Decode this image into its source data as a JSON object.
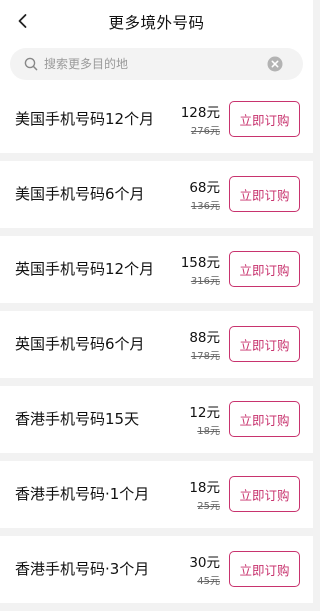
{
  "header": {
    "title": "更多境外号码",
    "back_icon": "chevron-left-icon"
  },
  "search": {
    "placeholder": "搜索更多目的地",
    "value": "",
    "search_icon": "search-icon",
    "clear_icon": "clear-icon"
  },
  "colors": {
    "accent": "#c8336e",
    "background": "#f2f2f2"
  },
  "items": [
    {
      "name": "美国手机号码12个月",
      "price": "128元",
      "original_price": "276元",
      "button": "立即订购"
    },
    {
      "name": "美国手机号码6个月",
      "price": "68元",
      "original_price": "136元",
      "button": "立即订购"
    },
    {
      "name": "英国手机号码12个月",
      "price": "158元",
      "original_price": "316元",
      "button": "立即订购"
    },
    {
      "name": "英国手机号码6个月",
      "price": "88元",
      "original_price": "178元",
      "button": "立即订购"
    },
    {
      "name": "香港手机号码15天",
      "price": "12元",
      "original_price": "18元",
      "button": "立即订购"
    },
    {
      "name": "香港手机号码·1个月",
      "price": "18元",
      "original_price": "25元",
      "button": "立即订购"
    },
    {
      "name": "香港手机号码·3个月",
      "price": "30元",
      "original_price": "45元",
      "button": "立即订购"
    }
  ]
}
